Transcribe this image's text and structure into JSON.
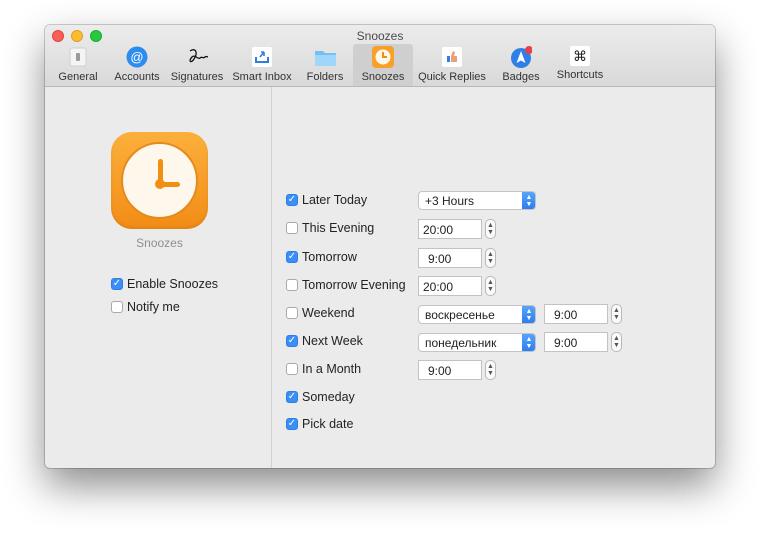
{
  "window": {
    "title": "Snoozes"
  },
  "toolbar": {
    "tabs": [
      {
        "label": "General",
        "icon": "general-icon"
      },
      {
        "label": "Accounts",
        "icon": "at-sign-icon"
      },
      {
        "label": "Signatures",
        "icon": "signature-icon"
      },
      {
        "label": "Smart Inbox",
        "icon": "smart-inbox-icon"
      },
      {
        "label": "Folders",
        "icon": "folder-icon"
      },
      {
        "label": "Snoozes",
        "icon": "clock-icon",
        "selected": true
      },
      {
        "label": "Quick Replies",
        "icon": "thumbs-up-icon"
      },
      {
        "label": "Badges",
        "icon": "badge-icon"
      },
      {
        "label": "Shortcuts",
        "icon": "command-icon"
      }
    ],
    "command_glyph": "⌘"
  },
  "left": {
    "app_icon_label": "Snoozes",
    "enable": {
      "label": "Enable Snoozes",
      "checked": true
    },
    "notify": {
      "label": "Notify me",
      "checked": false
    }
  },
  "options": [
    {
      "label": "Later Today",
      "checked": true,
      "popup": "+3 Hours"
    },
    {
      "label": "This Evening",
      "checked": false,
      "time": "20:00"
    },
    {
      "label": "Tomorrow",
      "checked": true,
      "time": "9:00"
    },
    {
      "label": "Tomorrow Evening",
      "checked": false,
      "time": "20:00"
    },
    {
      "label": "Weekend",
      "checked": false,
      "popup": "воскресенье",
      "time": "9:00"
    },
    {
      "label": "Next Week",
      "checked": true,
      "popup": "понедельник",
      "time": "9:00"
    },
    {
      "label": "In a Month",
      "checked": false,
      "time": "9:00"
    },
    {
      "label": "Someday",
      "checked": true
    },
    {
      "label": "Pick date",
      "checked": true
    }
  ],
  "glyphs": {
    "check": "✓",
    "up": "▲",
    "down": "▼"
  },
  "colors": {
    "accent": "#3b8ef5",
    "snooze_orange": "#f7a12a",
    "badge_red": "#e8404a"
  }
}
